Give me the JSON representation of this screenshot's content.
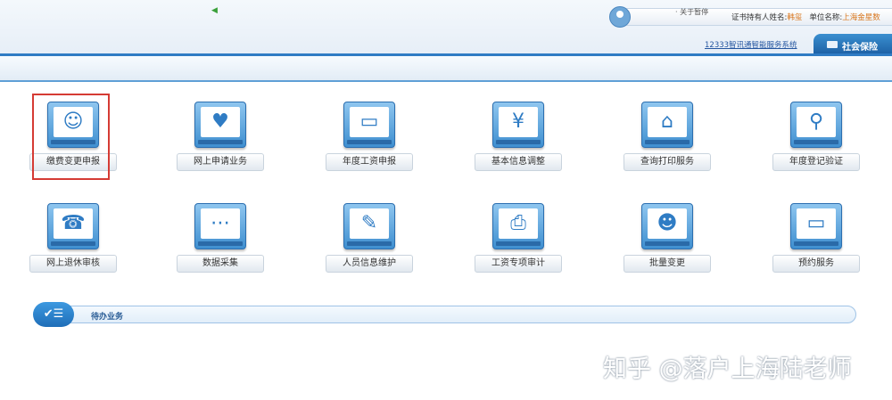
{
  "header": {
    "user_label": "证书持有人姓名:",
    "user_name": "韩玺",
    "unit_label": "单位名称:",
    "unit_name": "上海金星数",
    "system_link": "12333智讯通智能服务系统",
    "active_tab": "社会保险"
  },
  "notice": {
    "text": "· 关于暂停"
  },
  "tiles_row1": [
    {
      "label": "缴费变更申报",
      "icon": "payment-change-icon"
    },
    {
      "label": "网上申请业务",
      "icon": "online-apply-icon"
    },
    {
      "label": "年度工资申报",
      "icon": "monitor-icon"
    },
    {
      "label": "基本信息调整",
      "icon": "info-adjust-icon"
    },
    {
      "label": "查询打印服务",
      "icon": "home-icon"
    },
    {
      "label": "年度登记验证",
      "icon": "document-search-icon"
    }
  ],
  "tiles_row2": [
    {
      "label": "网上退休审核",
      "icon": "fax-icon"
    },
    {
      "label": "数据采集",
      "icon": "chat-icon"
    },
    {
      "label": "人员信息维护",
      "icon": "edit-document-icon"
    },
    {
      "label": "工资专项审计",
      "icon": "printer-icon"
    },
    {
      "label": "批量变更",
      "icon": "presentation-icon"
    },
    {
      "label": "预约服务",
      "icon": "monitor-icon"
    }
  ],
  "todo": {
    "title": "待办业务"
  },
  "watermark": "知乎 @落户上海陆老师",
  "colors": {
    "accent": "#2f7cc4",
    "selection": "#d53b34"
  }
}
